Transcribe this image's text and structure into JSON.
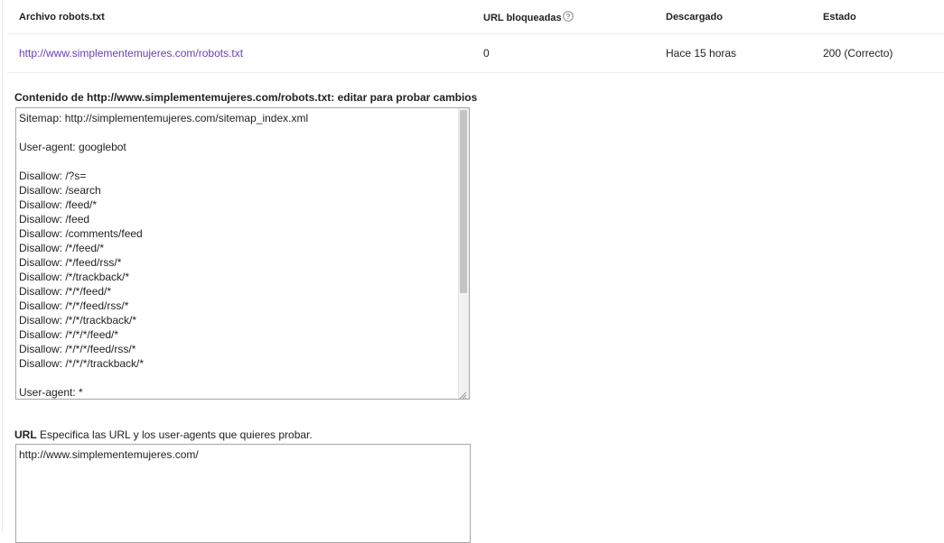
{
  "table": {
    "headers": {
      "file": "Archivo robots.txt",
      "blocked": "URL bloqueadas",
      "downloaded": "Descargado",
      "status": "Estado"
    },
    "row": {
      "file_link": "http://www.simplementemujeres.com/robots.txt",
      "blocked": "0",
      "downloaded": "Hace 15 horas",
      "status": "200 (Correcto)"
    }
  },
  "editor": {
    "title": "Contenido de http://www.simplementemujeres.com/robots.txt: editar para probar cambios",
    "content": "Sitemap: http://simplementemujeres.com/sitemap_index.xml\n\nUser-agent: googlebot\n\nDisallow: /?s=\nDisallow: /search\nDisallow: /feed/*\nDisallow: /feed\nDisallow: /comments/feed\nDisallow: /*/feed/*\nDisallow: /*/feed/rss/*\nDisallow: /*/trackback/*\nDisallow: /*/*/feed/*\nDisallow: /*/*/feed/rss/*\nDisallow: /*/*/trackback/*\nDisallow: /*/*/*/feed/*\nDisallow: /*/*/*/feed/rss/*\nDisallow: /*/*/*/trackback/*\n\nUser-agent: *"
  },
  "url_section": {
    "label": "URL",
    "description": "Especifica las URL y los user-agents que quieres probar.",
    "value": "http://www.simplementemujeres.com/"
  },
  "icons": {
    "help": "help-icon",
    "resize": "resize-handle-icon"
  },
  "colors": {
    "link": "#6a3fae",
    "border": "#a6a6a6"
  }
}
